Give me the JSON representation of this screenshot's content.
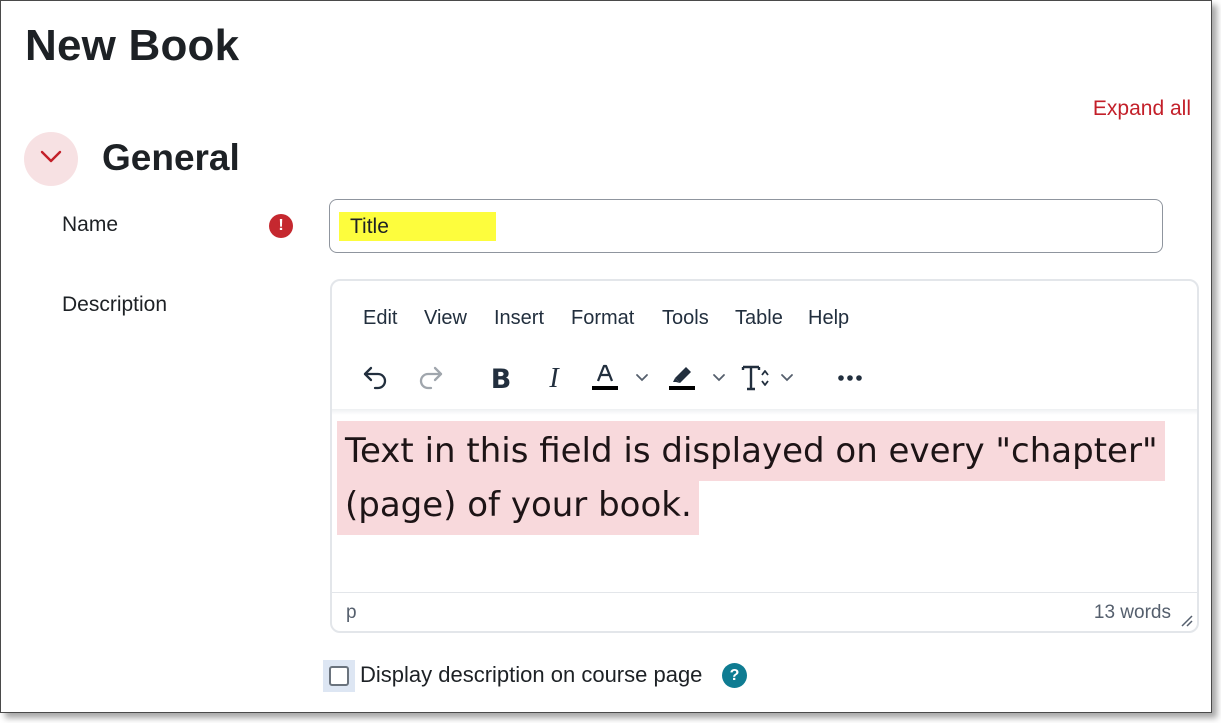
{
  "page": {
    "title": "New Book",
    "expand_all": "Expand all"
  },
  "section": {
    "title": "General",
    "toggle_icon": "chevron-down-icon"
  },
  "name_field": {
    "label": "Name",
    "value": "Title",
    "required_icon": "!"
  },
  "description_field": {
    "label": "Description",
    "menu": [
      "Edit",
      "View",
      "Insert",
      "Format",
      "Tools",
      "Table",
      "Help"
    ],
    "toolbar": [
      "undo-icon",
      "redo-icon",
      "bold-icon",
      "italic-icon",
      "text-color-icon",
      "highlight-icon",
      "font-size-icon",
      "more-icon"
    ],
    "content_lines": [
      "Text in this field is displayed on every \"chapter\"",
      "(page) of your book."
    ],
    "status_path": "p",
    "word_count": "13 words"
  },
  "display_description": {
    "label": "Display description on course page",
    "checked": false,
    "help_icon": "?"
  },
  "colors": {
    "accent": "#c31f29",
    "highlight_yellow": "#fdfd3d",
    "highlight_pink": "#f8d9dc",
    "help": "#0f7c92"
  }
}
